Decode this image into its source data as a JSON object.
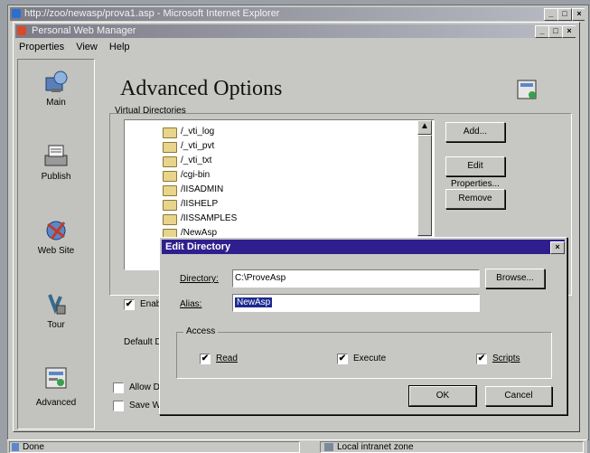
{
  "ie": {
    "title": "http://zoo/newasp/prova1.asp - Microsoft Internet Explorer",
    "status_text": "Done",
    "zone_text": "Local intranet zone"
  },
  "pwm": {
    "title": "Personal Web Manager",
    "menu": [
      "Properties",
      "View",
      "Help"
    ],
    "sidebar": [
      {
        "label": "Main",
        "icon": "main-icon"
      },
      {
        "label": "Publish",
        "icon": "publish-icon"
      },
      {
        "label": "Web Site",
        "icon": "website-icon"
      },
      {
        "label": "Tour",
        "icon": "tour-icon"
      },
      {
        "label": "Advanced",
        "icon": "advanced-icon"
      }
    ],
    "heading": "Advanced Options",
    "group_label": "Virtual Directories",
    "directories": [
      "/_vti_log",
      "/_vti_pvt",
      "/_vti_txt",
      "/cgi-bin",
      "/IISADMIN",
      "/IISHELP",
      "/IISSAMPLES",
      "/NewAsp"
    ],
    "buttons": {
      "add": "Add...",
      "edit": "Edit Properties...",
      "remove": "Remove"
    },
    "enable_label": "Enabl",
    "default_label": "Default D",
    "allow_label": "Allow Di",
    "save_label": "Save W"
  },
  "dialog": {
    "title": "Edit Directory",
    "directory_label": "Directory:",
    "directory_value": "C:\\ProveAsp",
    "alias_label": "Alias:",
    "alias_value": "NewAsp",
    "browse": "Browse...",
    "access_label": "Access",
    "read": "Read",
    "execute": "Execute",
    "scripts": "Scripts",
    "ok": "OK",
    "cancel": "Cancel"
  },
  "colors": {
    "dialog_title": "#2f1f8e",
    "face": "#c7c8c4",
    "selection": "#1c2a8f"
  }
}
